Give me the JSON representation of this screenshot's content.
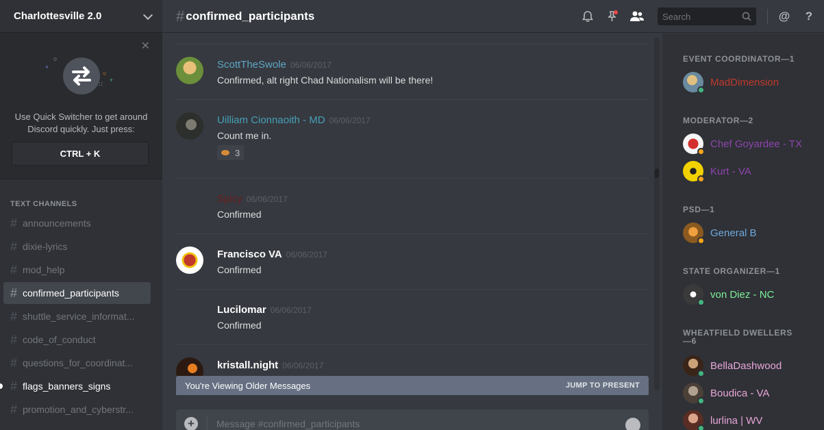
{
  "server": {
    "name": "Charlottesville 2.0"
  },
  "quick_switcher": {
    "text": "Use Quick Switcher to get around Discord quickly. Just press:",
    "shortcut": "CTRL + K"
  },
  "channels": {
    "category": "TEXT CHANNELS",
    "items": [
      {
        "name": "announcements",
        "state": "normal"
      },
      {
        "name": "dixie-lyrics",
        "state": "normal"
      },
      {
        "name": "mod_help",
        "state": "normal"
      },
      {
        "name": "confirmed_participants",
        "state": "active"
      },
      {
        "name": "shuttle_service_informat...",
        "state": "normal"
      },
      {
        "name": "code_of_conduct",
        "state": "normal"
      },
      {
        "name": "questions_for_coordinat...",
        "state": "normal"
      },
      {
        "name": "flags_banners_signs",
        "state": "unread"
      },
      {
        "name": "promotion_and_cyberstr...",
        "state": "normal"
      }
    ]
  },
  "header": {
    "hash": "#",
    "channel": "confirmed_participants",
    "search_placeholder": "Search",
    "icons": [
      "bell-icon",
      "pin-icon",
      "members-icon",
      "mention-icon",
      "help-icon"
    ],
    "at_symbol": "@",
    "help_symbol": "?"
  },
  "messages": [
    {
      "author": "ScottTheSwole",
      "author_color": "#5da7c4",
      "time": "06/06/2017",
      "text": "Confirmed, alt right Chad Nationalism will be there!"
    },
    {
      "author": "Uilliam Cionnaoith - MD",
      "author_color": "#46a0b8",
      "time": "06/06/2017",
      "text": "Count me in.",
      "reaction": {
        "emoji": "bread-icon",
        "count": "3"
      }
    },
    {
      "author": "Spicy",
      "author_color": "#6b1e1e",
      "time": "06/06/2017",
      "text": "Confirmed"
    },
    {
      "author": "Francisco VA",
      "author_color": "#ffffff",
      "time": "06/06/2017",
      "text": "Confirmed"
    },
    {
      "author": "Lucilomar",
      "author_color": "#ffffff",
      "time": "06/06/2017",
      "text": "Confirmed"
    },
    {
      "author": "kristall.night",
      "author_color": "#ffffff",
      "time": "06/06/2017",
      "text": ""
    }
  ],
  "older_bar": {
    "label": "You're Viewing Older Messages",
    "jump": "JUMP TO PRESENT"
  },
  "composer": {
    "placeholder": "Message #confirmed_participants"
  },
  "members": [
    {
      "role": "EVENT COORDINATOR—1",
      "people": [
        {
          "name": "MadDimension",
          "color": "#c0392b",
          "status": "#43b581"
        }
      ]
    },
    {
      "role": "MODERATOR—2",
      "people": [
        {
          "name": "Chef Goyardee - TX",
          "color": "#8e44ad",
          "status": "#faa61a"
        },
        {
          "name": "Kurt - VA",
          "color": "#8e44ad",
          "status": "#faa61a"
        }
      ]
    },
    {
      "role": "PSD—1",
      "people": [
        {
          "name": "General B",
          "color": "#6fa8dc",
          "status": "#faa61a"
        }
      ]
    },
    {
      "role": "STATE ORGANIZER—1",
      "people": [
        {
          "name": "von Diez - NC",
          "color": "#7cf09a",
          "status": "#43b581"
        }
      ]
    },
    {
      "role": "WHEATFIELD DWELLERS—6",
      "people": [
        {
          "name": "BellaDashwood",
          "color": "#e8a6d8",
          "status": "#43b581"
        },
        {
          "name": "Boudica - VA",
          "color": "#e8a6d8",
          "status": "#43b581"
        },
        {
          "name": "lurlina | WV",
          "color": "#e8a6d8",
          "status": "#43b581"
        }
      ]
    }
  ]
}
